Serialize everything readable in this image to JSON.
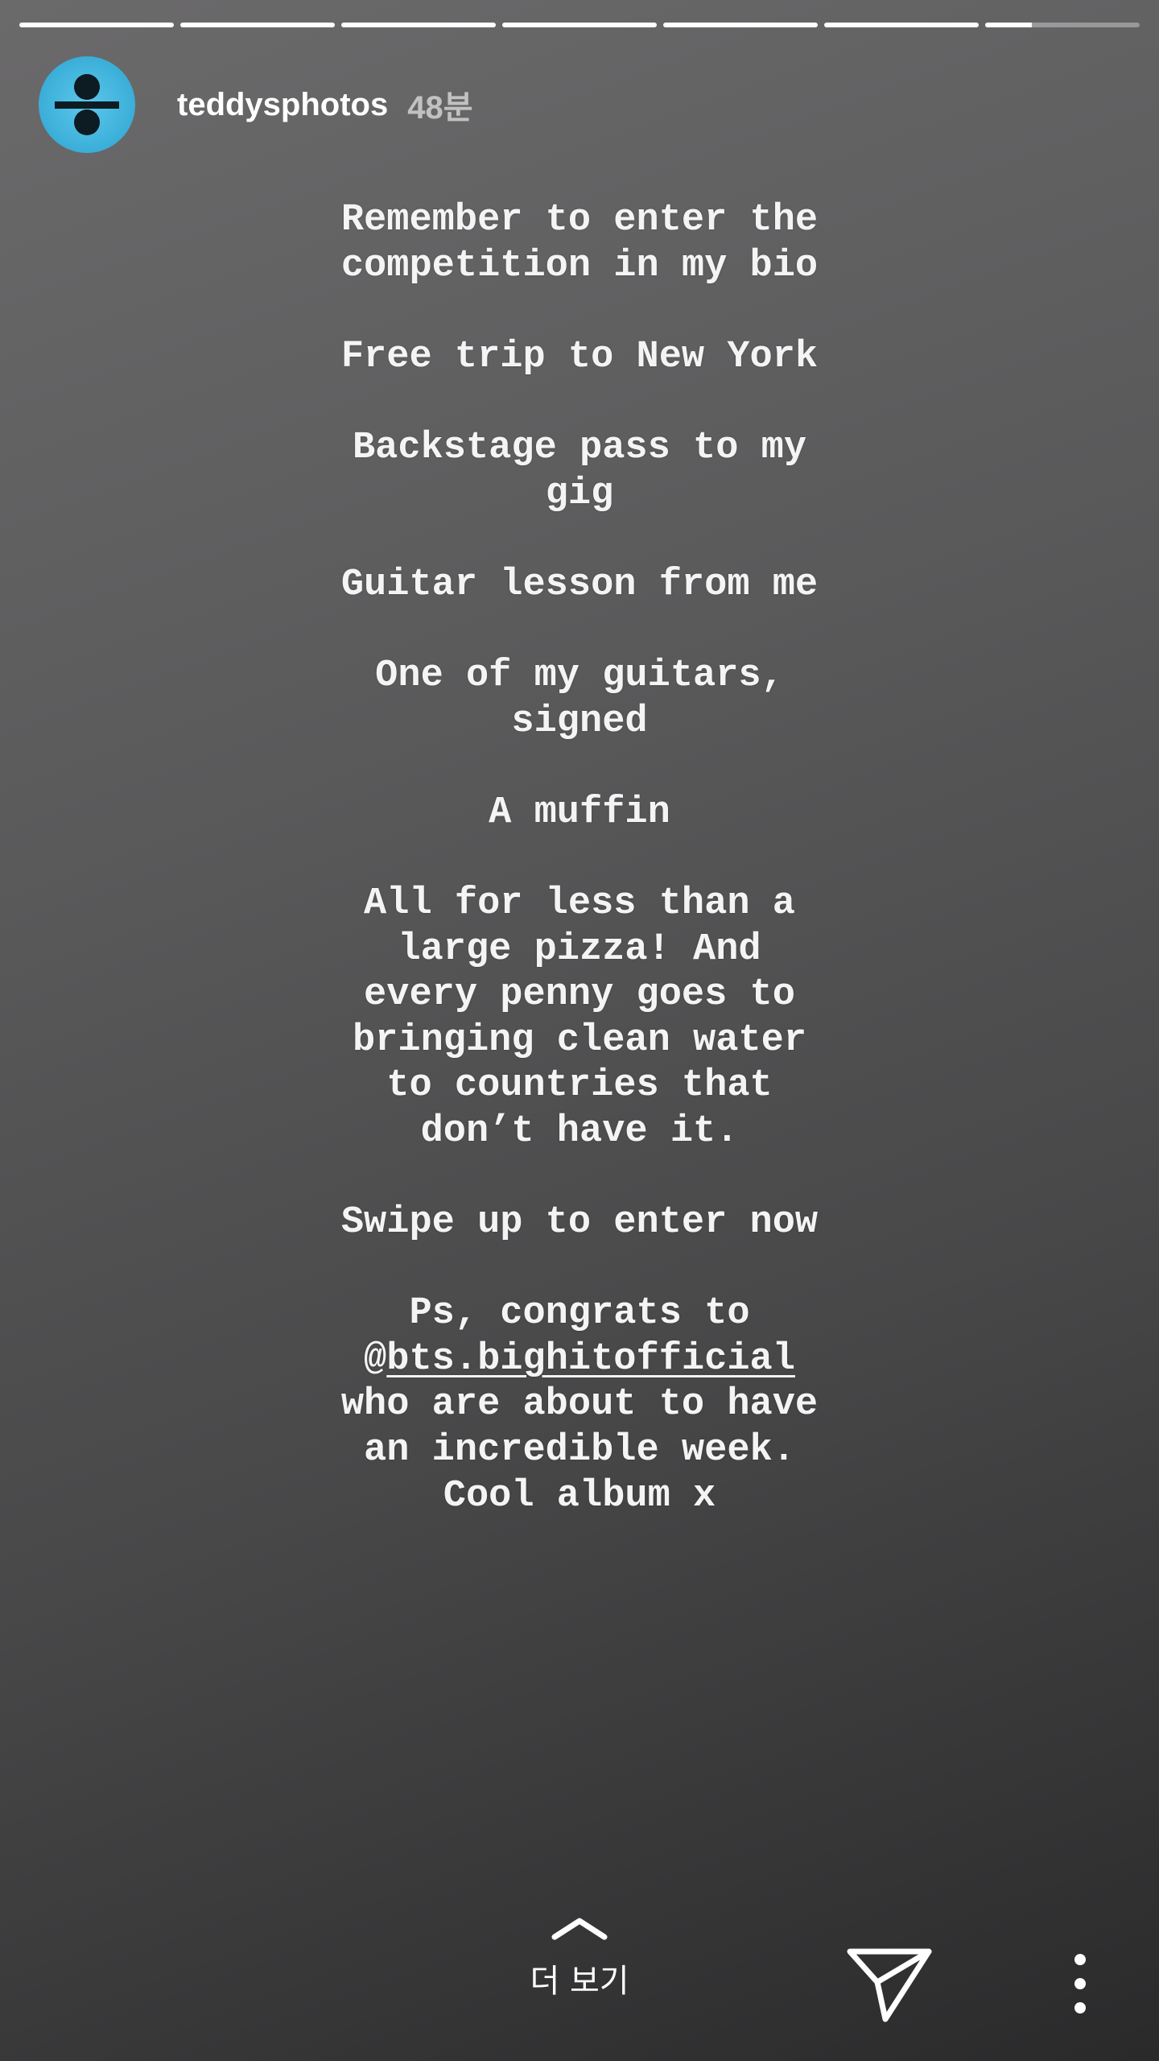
{
  "progress": {
    "segments": [
      1,
      1,
      1,
      1,
      1,
      1,
      0.3
    ]
  },
  "header": {
    "username": "teddysphotos",
    "time_ago": "48분"
  },
  "message": {
    "lines": [
      "Remember to enter the",
      "competition in my bio",
      "",
      "Free trip to New York",
      "",
      "Backstage pass to my",
      "gig",
      "",
      "Guitar lesson from me",
      "",
      "One of my guitars,",
      "signed",
      "",
      "A muffin",
      "",
      "All for less than a",
      "large pizza! And",
      "every penny goes to",
      "bringing clean water",
      "to countries that",
      "don’t have it.",
      "",
      "Swipe up to enter now",
      "",
      "Ps, congrats to",
      "@",
      "who are about to have",
      "an incredible week.",
      "Cool album x"
    ],
    "mention": "bts.bighitofficial"
  },
  "footer": {
    "more_label": "더 보기",
    "icons": {
      "swipe_up": "chevron-up-icon",
      "send": "paper-plane-icon",
      "menu": "more-vertical-icon"
    }
  }
}
